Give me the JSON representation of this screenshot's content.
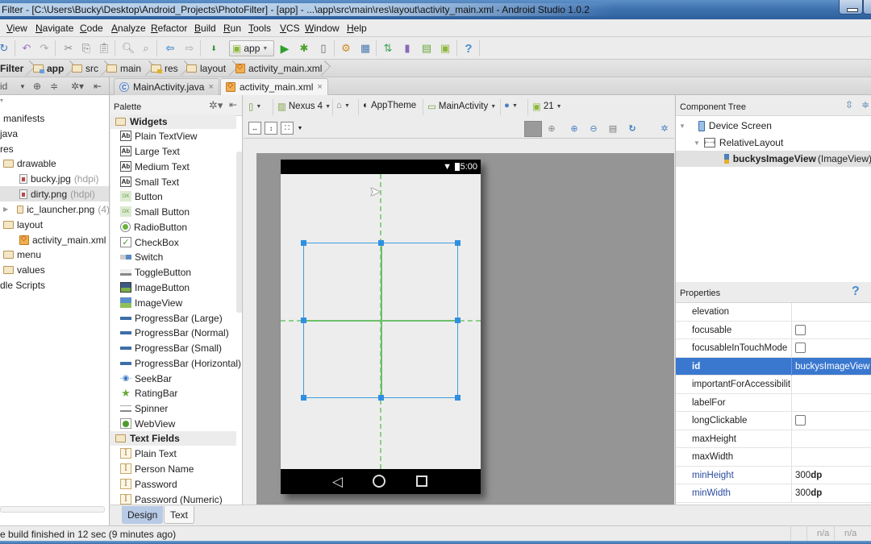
{
  "window": {
    "title": "Filter - [C:\\Users\\Bucky\\Desktop\\Android_Projects\\PhotoFilter] - [app] - ...\\app\\src\\main\\res\\layout\\activity_main.xml - Android Studio 1.0.2"
  },
  "menu": [
    "View",
    "Navigate",
    "Code",
    "Analyze",
    "Refactor",
    "Build",
    "Run",
    "Tools",
    "VCS",
    "Window",
    "Help"
  ],
  "toolbar": {
    "run_config": "app"
  },
  "breadcrumb": [
    "Filter",
    "app",
    "src",
    "main",
    "res",
    "layout",
    "activity_main.xml"
  ],
  "project_tools": {
    "view_selector": "id"
  },
  "editor_tabs": [
    {
      "label": "MainActivity.java",
      "close": "×",
      "active": false
    },
    {
      "label": "activity_main.xml",
      "close": "×",
      "active": true
    }
  ],
  "project_tree": [
    {
      "label": "manifests"
    },
    {
      "label": "java"
    },
    {
      "label": "res"
    },
    {
      "label": "drawable"
    },
    {
      "label": "bucky.jpg",
      "qualifier": "(hdpi)"
    },
    {
      "label": "dirty.png",
      "qualifier": "(hdpi)",
      "selected": true
    },
    {
      "label": "ic_launcher.png",
      "qualifier": "(4)"
    },
    {
      "label": "layout"
    },
    {
      "label": "activity_main.xml"
    },
    {
      "label": "menu"
    },
    {
      "label": "values"
    },
    {
      "label": "dle Scripts"
    }
  ],
  "palette": {
    "title": "Palette",
    "groups": [
      {
        "label": "Widgets",
        "items": [
          {
            "label": "Plain TextView",
            "icon": "textview-icon"
          },
          {
            "label": "Large Text",
            "icon": "textview-icon"
          },
          {
            "label": "Medium Text",
            "icon": "textview-icon"
          },
          {
            "label": "Small Text",
            "icon": "textview-icon"
          },
          {
            "label": "Button",
            "icon": "button-icon"
          },
          {
            "label": "Small Button",
            "icon": "button-icon"
          },
          {
            "label": "RadioButton",
            "icon": "radio-icon"
          },
          {
            "label": "CheckBox",
            "icon": "checkbox-icon"
          },
          {
            "label": "Switch",
            "icon": "switch-icon"
          },
          {
            "label": "ToggleButton",
            "icon": "toggle-icon"
          },
          {
            "label": "ImageButton",
            "icon": "imagebutton-icon"
          },
          {
            "label": "ImageView",
            "icon": "imageview-icon"
          },
          {
            "label": "ProgressBar (Large)",
            "icon": "progressbar-icon"
          },
          {
            "label": "ProgressBar (Normal)",
            "icon": "progressbar-icon"
          },
          {
            "label": "ProgressBar (Small)",
            "icon": "progressbar-icon"
          },
          {
            "label": "ProgressBar (Horizontal)",
            "icon": "progressbar-icon"
          },
          {
            "label": "SeekBar",
            "icon": "seekbar-icon"
          },
          {
            "label": "RatingBar",
            "icon": "star-icon"
          },
          {
            "label": "Spinner",
            "icon": "spinner-icon"
          },
          {
            "label": "WebView",
            "icon": "webview-icon"
          }
        ]
      },
      {
        "label": "Text Fields",
        "items": [
          {
            "label": "Plain Text",
            "icon": "textfield-icon"
          },
          {
            "label": "Person Name",
            "icon": "textfield-icon"
          },
          {
            "label": "Password",
            "icon": "textfield-icon"
          },
          {
            "label": "Password (Numeric)",
            "icon": "textfield-icon"
          }
        ]
      }
    ]
  },
  "editor_toolbar": {
    "device": "Nexus 4",
    "theme": "AppTheme",
    "activity": "MainActivity",
    "api_level": "21"
  },
  "phone": {
    "time": "5:00"
  },
  "bottom_tabs": {
    "design": "Design",
    "text": "Text",
    "active": "Design"
  },
  "component_tree": {
    "title": "Component Tree",
    "nodes": [
      {
        "label": "Device Screen"
      },
      {
        "label": "RelativeLayout"
      },
      {
        "label": "buckysImageView",
        "type": "(ImageView)",
        "selected": true
      }
    ]
  },
  "properties": {
    "title": "Properties",
    "help": "?",
    "rows": [
      {
        "name": "elevation",
        "value": ""
      },
      {
        "name": "focusable",
        "checkbox": true,
        "checked": false
      },
      {
        "name": "focusableInTouchMode",
        "checkbox": true,
        "checked": false
      },
      {
        "name": "id",
        "value": "buckysImageView",
        "selected": true
      },
      {
        "name": "importantForAccessibility",
        "value": ""
      },
      {
        "name": "labelFor",
        "value": ""
      },
      {
        "name": "longClickable",
        "checkbox": true,
        "checked": false
      },
      {
        "name": "maxHeight",
        "value": ""
      },
      {
        "name": "maxWidth",
        "value": ""
      },
      {
        "name": "minHeight",
        "value_num": "300",
        "value_unit": "dp",
        "modified": true
      },
      {
        "name": "minWidth",
        "value_num": "300",
        "value_unit": "dp",
        "modified": true
      }
    ]
  },
  "status": {
    "message": "e build finished in 12 sec (9 minutes ago)",
    "fields": [
      "n/a",
      "n/a"
    ]
  },
  "colors": {
    "selection_blue": "#3a78d0",
    "guide_green": "#8ccf8a",
    "handle_blue": "#2f8fe0",
    "design_tab": "#b8cbe6"
  }
}
